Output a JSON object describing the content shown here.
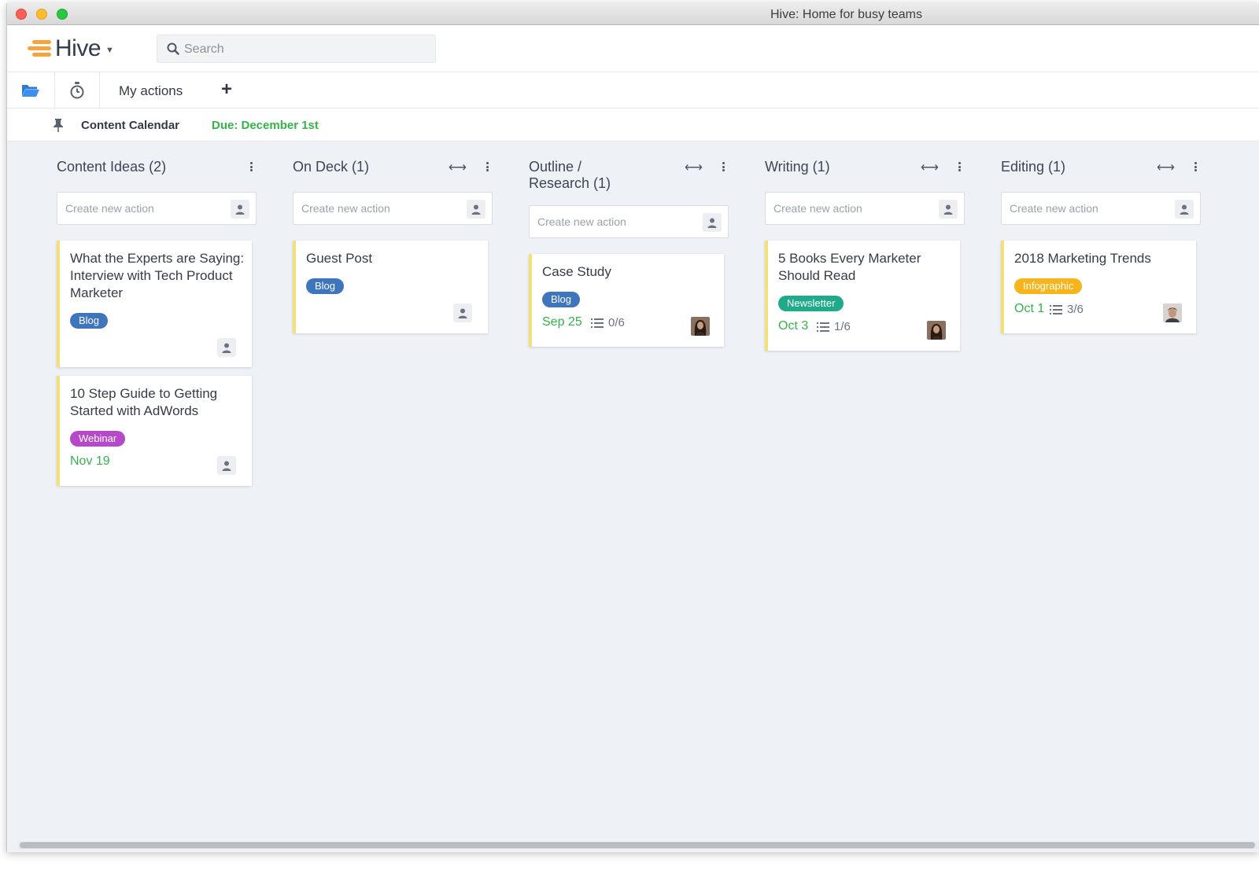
{
  "window": {
    "title": "Hive: Home for busy teams"
  },
  "app": {
    "name": "Hive",
    "logo_color": "#f7a33d"
  },
  "search": {
    "placeholder": "Search",
    "value": ""
  },
  "nav": {
    "icons": [
      "folder-icon",
      "stopwatch-icon"
    ],
    "tab_label": "My actions",
    "add_label": "+"
  },
  "project": {
    "name": "Content Calendar",
    "due": "Due: December 1st",
    "due_color": "#35b34a"
  },
  "colors": {
    "card_accent": "#f2e07a",
    "due_green": "#35b34a",
    "background": "#eef1f6"
  },
  "columns": [
    {
      "title": "Content Ideas (2)",
      "create_placeholder": "Create new action",
      "cards": [
        {
          "title": "What the Experts are Saying: Interview with Tech Product Marketer",
          "tag": "Blog",
          "tag_color": "#3f75bd"
        },
        {
          "title": "10 Step Guide to Getting Started with AdWords",
          "tag": "Webinar",
          "tag_color": "#b549c9",
          "due": "Nov 19"
        }
      ]
    },
    {
      "title": "On Deck (1)",
      "create_placeholder": "Create new action",
      "cards": [
        {
          "title": "Guest Post",
          "tag": "Blog",
          "tag_color": "#3f75bd"
        }
      ]
    },
    {
      "title": "Outline / Research (1)",
      "title_line1": "Outline /",
      "title_line2": "Research (1)",
      "create_placeholder": "Create new action",
      "cards": [
        {
          "title": "Case Study",
          "tag": "Blog",
          "tag_color": "#3f75bd",
          "due": "Sep 25",
          "checklist": "0/6",
          "assignee": "avatar-woman"
        }
      ]
    },
    {
      "title": "Writing (1)",
      "create_placeholder": "Create new action",
      "cards": [
        {
          "title": "5 Books Every Marketer Should Read",
          "tag": "Newsletter",
          "tag_color": "#1fab89",
          "due": "Oct 3",
          "checklist": "1/6",
          "assignee": "avatar-woman"
        }
      ]
    },
    {
      "title": "Editing (1)",
      "create_placeholder": "Create new action",
      "cards": [
        {
          "title": "2018 Marketing Trends",
          "tag": "Infographic",
          "tag_color": "#f5b51b",
          "due": "Oct 1",
          "checklist": "3/6",
          "assignee": "avatar-man"
        }
      ]
    }
  ]
}
